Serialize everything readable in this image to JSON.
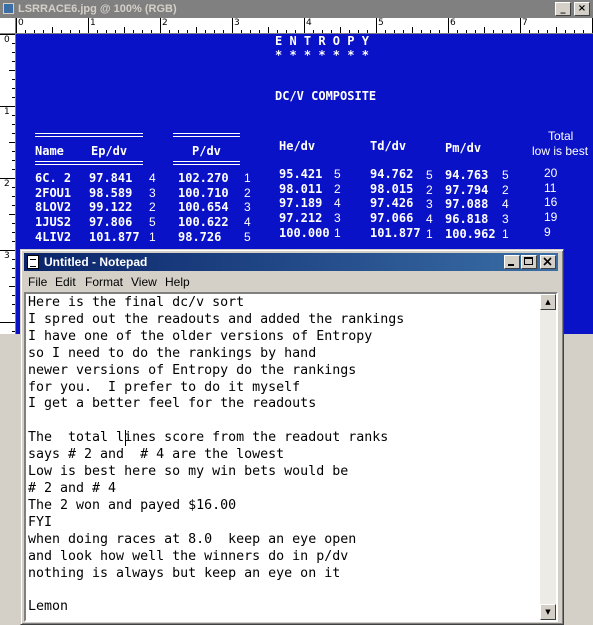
{
  "image_window": {
    "title": "LSRRACE6.jpg @ 100% (RGB)",
    "buttons": {
      "minimize": "_",
      "close": "×"
    },
    "ruler_top_numbers": [
      "0",
      "1",
      "2",
      "3",
      "4",
      "5",
      "6",
      "7"
    ],
    "ruler_left_numbers": [
      "0",
      "1",
      "2",
      "3"
    ]
  },
  "screen": {
    "title": "E N T R O P Y",
    "stars": "* * * * * * *",
    "subtitle": "DC/V COMPOSITE",
    "total_label": [
      "Total",
      "low is best"
    ],
    "headers": {
      "name": "Name",
      "ep": "Ep/dv",
      "p": "P/dv",
      "he": "He/dv",
      "td": "Td/dv",
      "pm": "Pm/dv"
    },
    "rows": [
      {
        "name": "6C. 2",
        "ep": "97.841",
        "ep_rank": "4",
        "p": "102.270",
        "p_rank": "1",
        "he": "95.421",
        "he_rank": "5",
        "td": "94.762",
        "td_rank": "5",
        "pm": "94.763",
        "pm_rank": "5",
        "total": "20"
      },
      {
        "name": "2FOU1",
        "ep": "98.589",
        "ep_rank": "3",
        "p": "100.710",
        "p_rank": "2",
        "he": "98.011",
        "he_rank": "2",
        "td": "98.015",
        "td_rank": "2",
        "pm": "97.794",
        "pm_rank": "2",
        "total": "11"
      },
      {
        "name": "8LOV2",
        "ep": "99.122",
        "ep_rank": "2",
        "p": "100.654",
        "p_rank": "3",
        "he": "97.189",
        "he_rank": "4",
        "td": "97.426",
        "td_rank": "3",
        "pm": "97.088",
        "pm_rank": "4",
        "total": "16"
      },
      {
        "name": "1JUS2",
        "ep": "97.806",
        "ep_rank": "5",
        "p": "100.622",
        "p_rank": "4",
        "he": "97.212",
        "he_rank": "3",
        "td": "97.066",
        "td_rank": "4",
        "pm": "96.818",
        "pm_rank": "3",
        "total": "19"
      },
      {
        "name": "4LIV2",
        "ep": "101.877",
        "ep_rank": "1",
        "p": "98.726",
        "p_rank": "5",
        "he": "100.000",
        "he_rank": "1",
        "td": "101.877",
        "td_rank": "1",
        "pm": "100.962",
        "pm_rank": "1",
        "total": "9"
      }
    ]
  },
  "notepad": {
    "title": "Untitled - Notepad",
    "menu": [
      "File",
      "Edit",
      "Format",
      "View",
      "Help"
    ],
    "text": "Here is the final dc/v sort\nI spred out the readouts and added the rankings\nI have one of the older versions of Entropy\nso I need to do the rankings by hand\nnewer versions of Entropy do the rankings\nfor you.  I prefer to do it myself\nI get a better feel for the readouts\n\nThe  total lines score from the readout ranks\nsays # 2 and  # 4 are the lowest\nLow is best here so my win bets would be\n# 2 and # 4\nThe 2 won and payed $16.00\nFYI\nwhen doing races at 8.0  keep an eye open\nand look how well the winners do in p/dv\nnothing is always but keep an eye on it\n\nLemon"
  },
  "colors": {
    "screen_bg": "#0a12c8",
    "title_active": "#0a246a",
    "title_inactive": "#808080"
  }
}
